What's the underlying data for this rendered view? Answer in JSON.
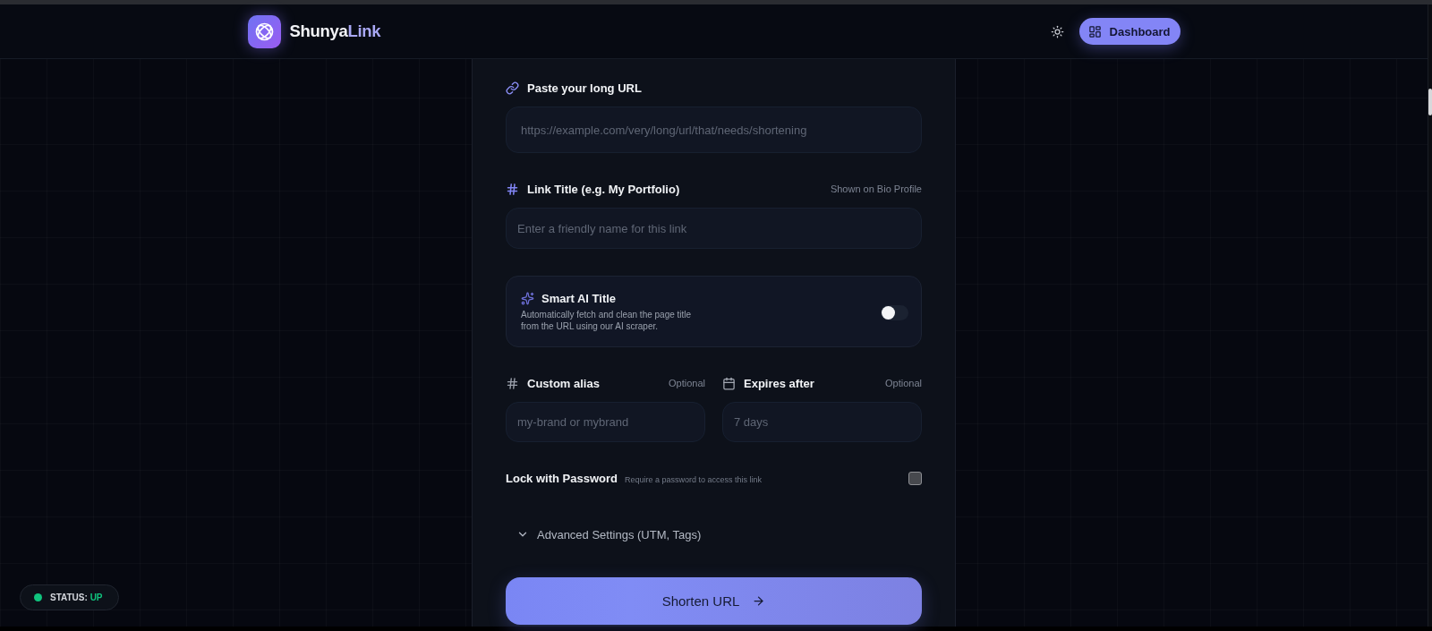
{
  "header": {
    "brand": {
      "name": "Shunya",
      "accent": "Link"
    },
    "dashboard_button": {
      "label": "Dashboard"
    }
  },
  "form": {
    "url": {
      "label": "Paste your long URL",
      "placeholder": "https://example.com/very/long/url/that/needs/shortening"
    },
    "title": {
      "label": "Link Title (e.g. My Portfolio)",
      "hint": "Shown on Bio Profile",
      "placeholder": "Enter a friendly name for this link"
    },
    "smart_ai": {
      "title": "Smart AI Title",
      "description": "Automatically fetch and clean the page title from the URL using our AI scraper.",
      "on": false
    },
    "alias": {
      "label": "Custom alias",
      "hint": "Optional",
      "placeholder": "my-brand or mybrand"
    },
    "expires": {
      "label": "Expires after",
      "hint": "Optional",
      "placeholder": "7 days"
    },
    "password_lock": {
      "label": "Lock with Password",
      "description": "Require a password to access this link",
      "checked": false
    },
    "advanced": {
      "label": "Advanced Settings (UTM, Tags)",
      "expanded": false
    },
    "submit": {
      "label": "Shorten URL"
    }
  },
  "status": {
    "label": "STATUS:",
    "value": "UP",
    "kind": "up"
  }
}
